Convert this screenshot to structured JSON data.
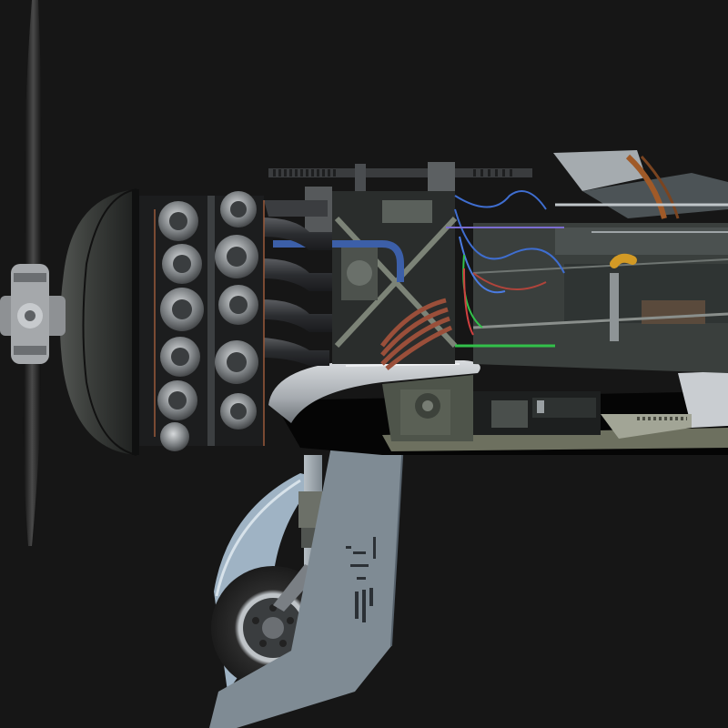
{
  "image": {
    "background_color": "#161616",
    "subject": "cutaway-aircraft-engine-render",
    "elements": [
      "propeller-blade-upper-icon",
      "propeller-blade-lower-icon",
      "propeller-hub-icon",
      "engine-cowling-icon",
      "radial-engine-cylinders-icon",
      "exhaust-pipes-icon",
      "machine-gun-barrel-icon",
      "wiring-harness-icon",
      "cockpit-frame-icon",
      "control-stick-icon",
      "wing-root-icon",
      "landing-gear-strut-icon",
      "landing-gear-door-icon",
      "wheel-icon"
    ]
  },
  "palette": {
    "dark_metal": "#2b2d2f",
    "mid_metal": "#6d7073",
    "light_metal": "#b9bdc0",
    "paint_gray": "#8b969e",
    "olive": "#5f6455",
    "wire_blue": "#3f6ed0",
    "wire_green": "#32c04a",
    "wire_red": "#b0443b",
    "brass": "#b98a4a",
    "seat_orange": "#c7841f",
    "tire": "#262626"
  }
}
